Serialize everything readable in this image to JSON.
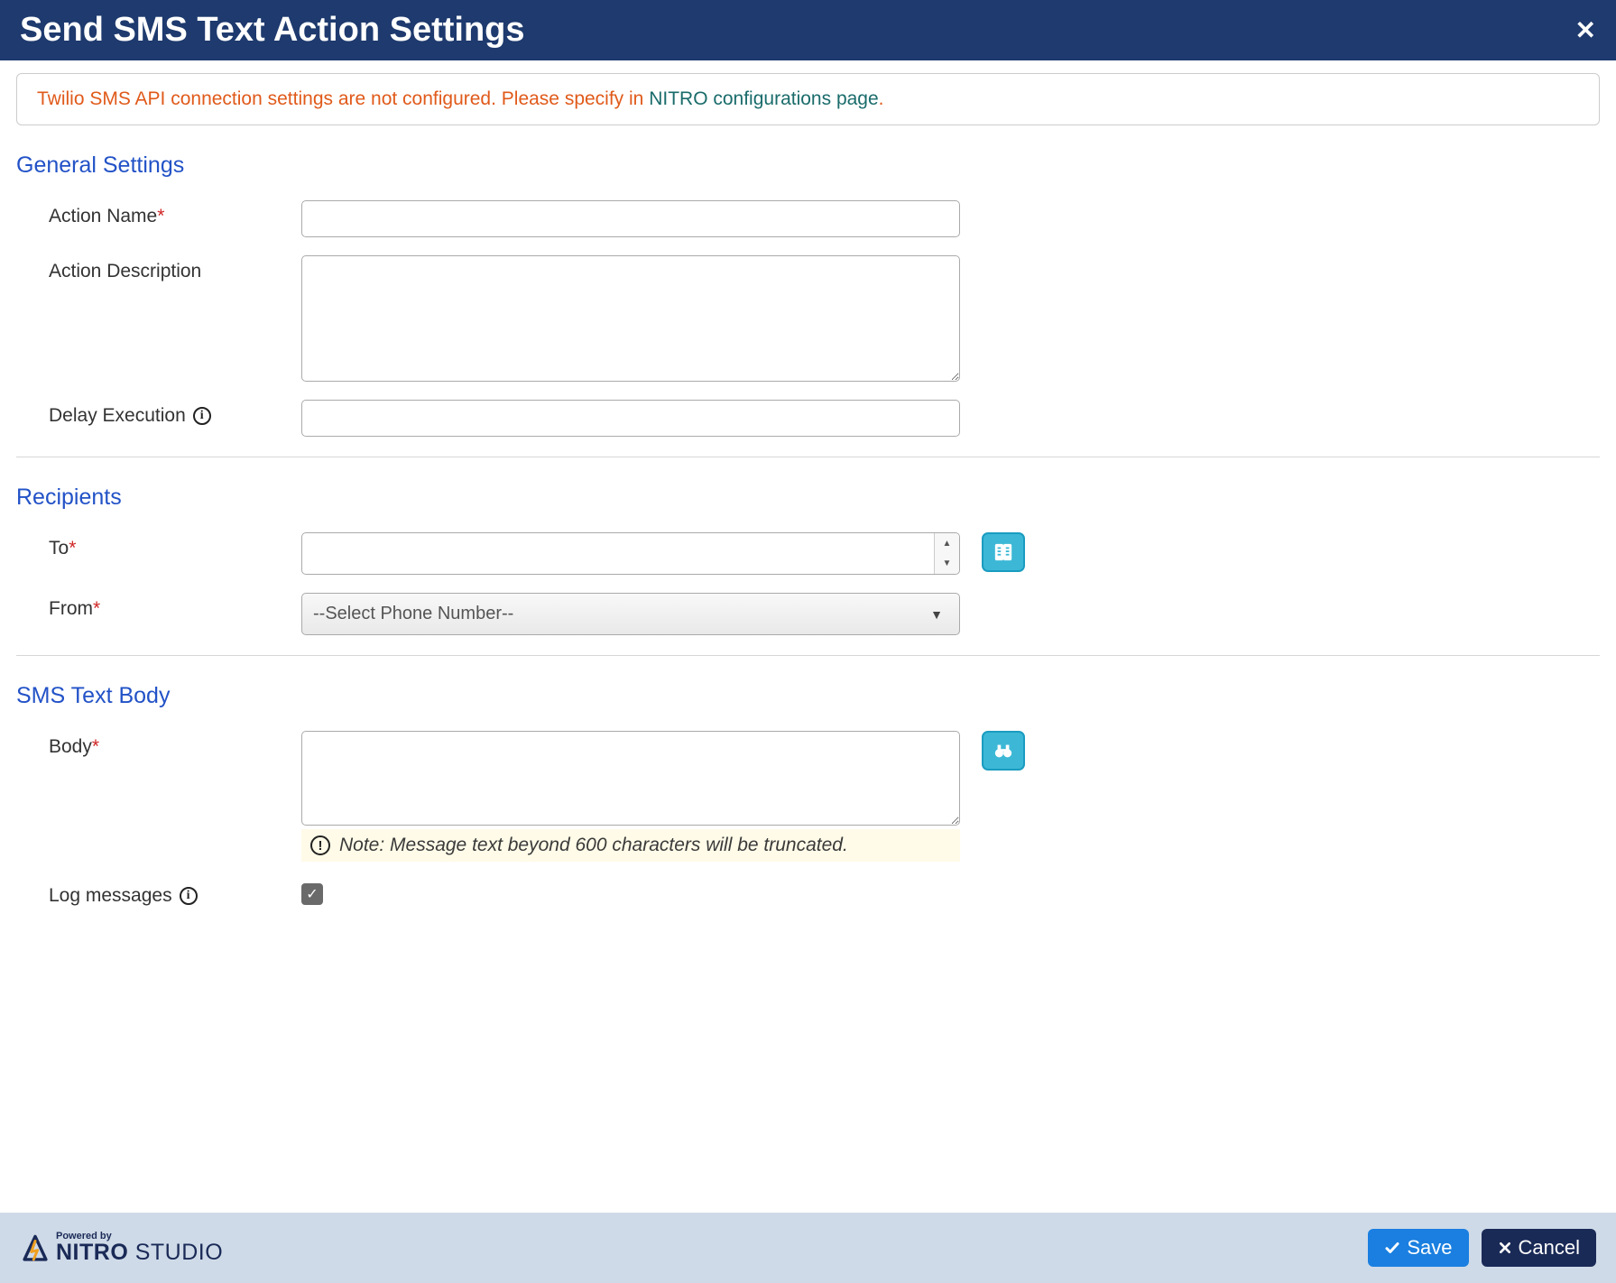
{
  "header": {
    "title": "Send SMS Text Action Settings"
  },
  "alert": {
    "text_prefix": "Twilio SMS API connection settings are not configured. Please specify in ",
    "link_text": "NITRO configurations page",
    "text_suffix": "."
  },
  "sections": {
    "general": {
      "title": "General Settings",
      "action_name": {
        "label": "Action Name",
        "value": ""
      },
      "action_description": {
        "label": "Action Description",
        "value": ""
      },
      "delay_execution": {
        "label": "Delay Execution",
        "value": ""
      }
    },
    "recipients": {
      "title": "Recipients",
      "to": {
        "label": "To",
        "value": ""
      },
      "from": {
        "label": "From",
        "selected": "--Select Phone Number--"
      }
    },
    "body": {
      "title": "SMS Text Body",
      "body_field": {
        "label": "Body",
        "value": ""
      },
      "note": "Note: Message text beyond 600 characters will be truncated.",
      "log_messages": {
        "label": "Log messages",
        "checked": true
      }
    }
  },
  "footer": {
    "powered_by": "Powered by",
    "brand_bold": "NITRO",
    "brand_thin": " STUDIO",
    "save": "Save",
    "cancel": "Cancel"
  }
}
